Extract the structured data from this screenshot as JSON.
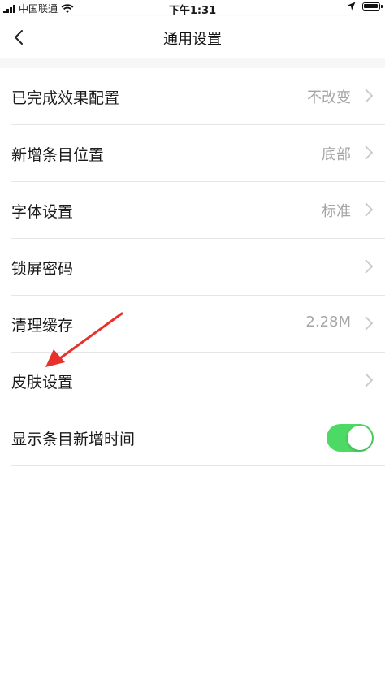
{
  "status_bar": {
    "carrier": "中国联通",
    "time": "下午1:31"
  },
  "header": {
    "title": "通用设置"
  },
  "settings": {
    "items": [
      {
        "label": "已完成效果配置",
        "value": "不改变"
      },
      {
        "label": "新增条目位置",
        "value": "底部"
      },
      {
        "label": "字体设置",
        "value": "标准"
      },
      {
        "label": "锁屏密码",
        "value": ""
      },
      {
        "label": "清理缓存",
        "value": "2.28M"
      },
      {
        "label": "皮肤设置",
        "value": ""
      }
    ],
    "toggle_item": {
      "label": "显示条目新增时间",
      "enabled": true
    }
  },
  "colors": {
    "toggle_on": "#4cd964",
    "annotation_arrow": "#e8312a",
    "secondary_text": "#a6a6a6"
  },
  "icons": {
    "back": "chevron-left-icon",
    "row_arrow": "chevron-right-icon",
    "wifi": "wifi-icon",
    "location": "location-arrow-icon",
    "battery": "battery-icon"
  }
}
